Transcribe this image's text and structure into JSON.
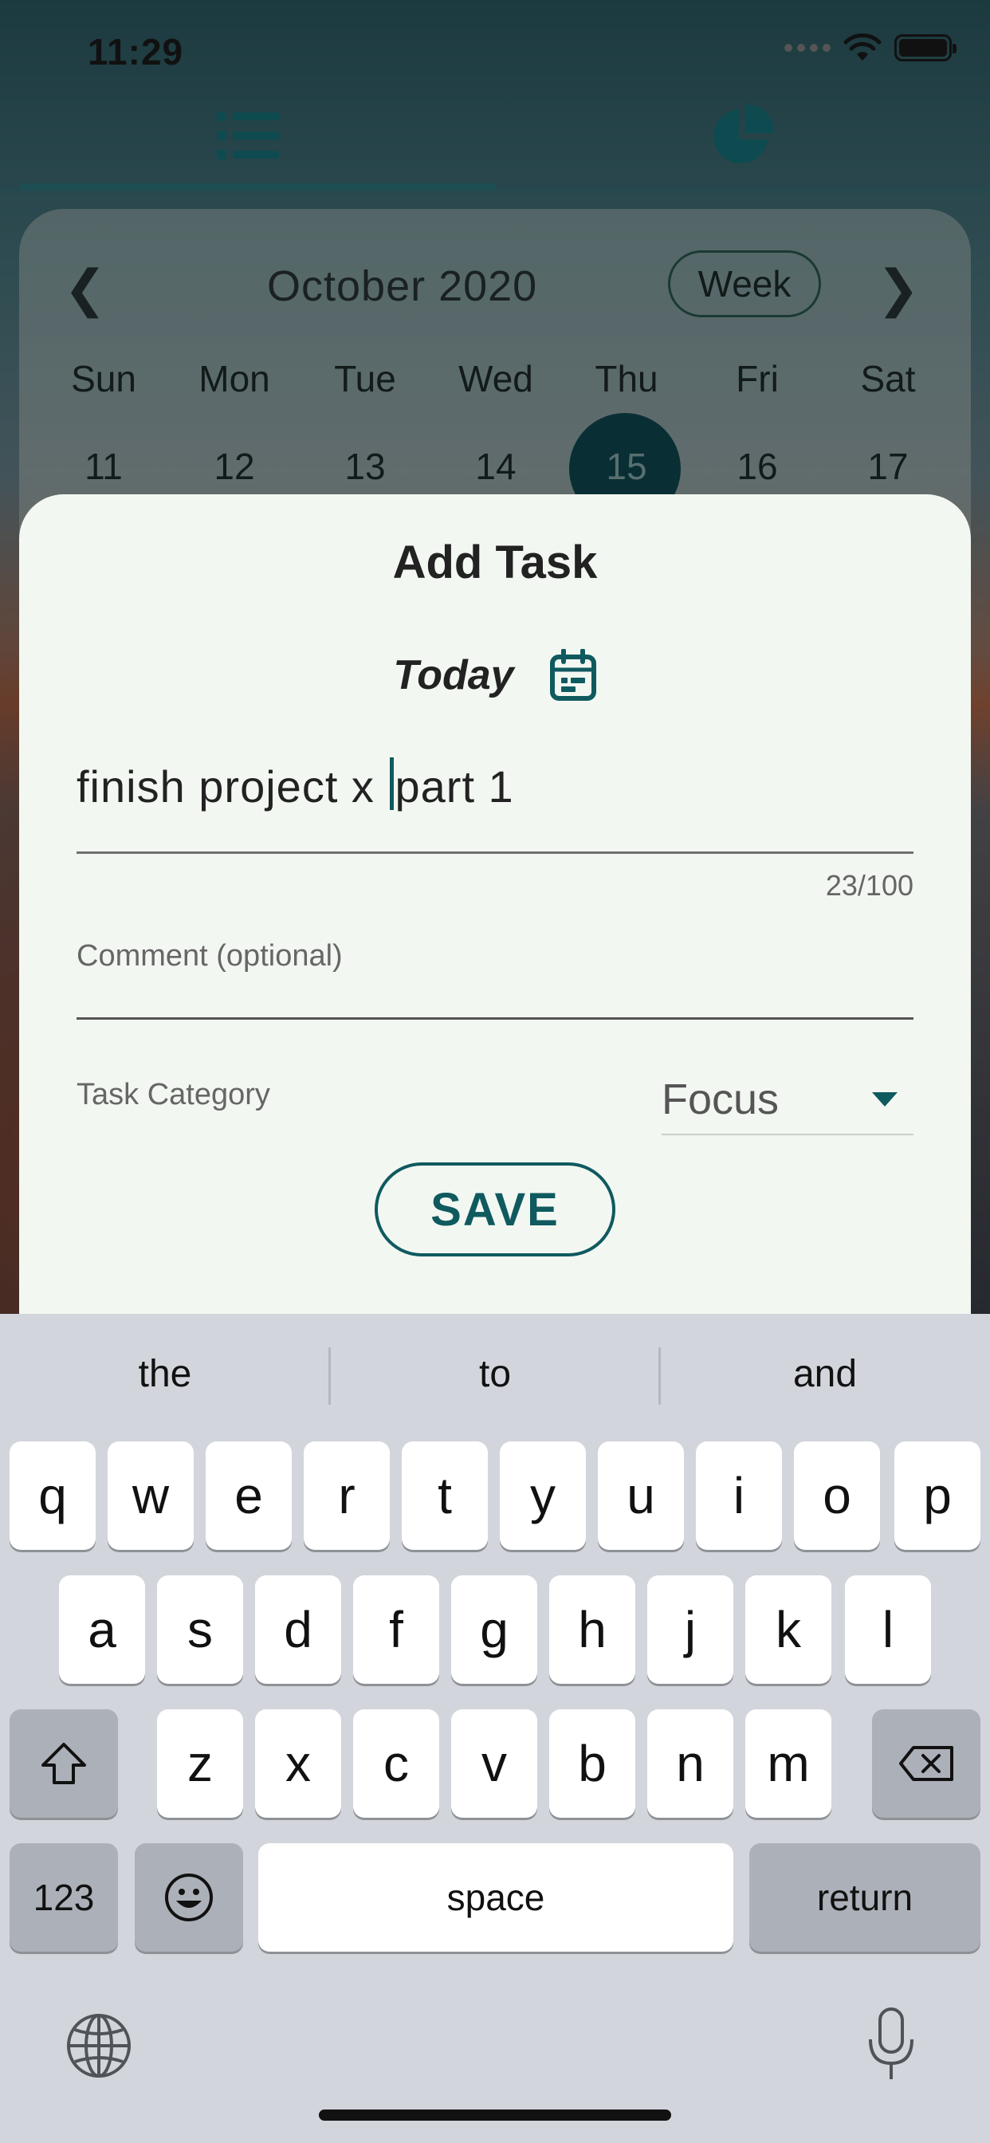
{
  "status_bar": {
    "time": "11:29"
  },
  "header": {
    "tabs": [
      {
        "name": "list",
        "icon": "list-icon",
        "selected": true
      },
      {
        "name": "stats",
        "icon": "pie-chart-icon",
        "selected": false
      }
    ]
  },
  "calendar": {
    "month_label": "October 2020",
    "view_button": "Week",
    "weekdays": [
      "Sun",
      "Mon",
      "Tue",
      "Wed",
      "Thu",
      "Fri",
      "Sat"
    ],
    "dates": [
      "11",
      "12",
      "13",
      "14",
      "15",
      "16",
      "17"
    ],
    "selected_date": "15"
  },
  "sheet": {
    "title": "Add Task",
    "date_label": "Today",
    "task_text_before_caret": "finish project x ",
    "task_text_after_caret": "part 1",
    "char_counter": "23/100",
    "comment_placeholder": "Comment (optional)",
    "category_label": "Task Category",
    "category_value": "Focus",
    "save_label": "SAVE"
  },
  "keyboard": {
    "suggestions": [
      "the",
      "to",
      "and"
    ],
    "row1": [
      "q",
      "w",
      "e",
      "r",
      "t",
      "y",
      "u",
      "i",
      "o",
      "p"
    ],
    "row2": [
      "a",
      "s",
      "d",
      "f",
      "g",
      "h",
      "j",
      "k",
      "l"
    ],
    "row3": [
      "z",
      "x",
      "c",
      "v",
      "b",
      "n",
      "m"
    ],
    "numbers_key": "123",
    "space_key": "space",
    "return_key": "return"
  },
  "colors": {
    "accent": "#0f5a5f",
    "sheet_bg": "#f3f7f2",
    "keyboard_bg": "#d2d5db"
  }
}
